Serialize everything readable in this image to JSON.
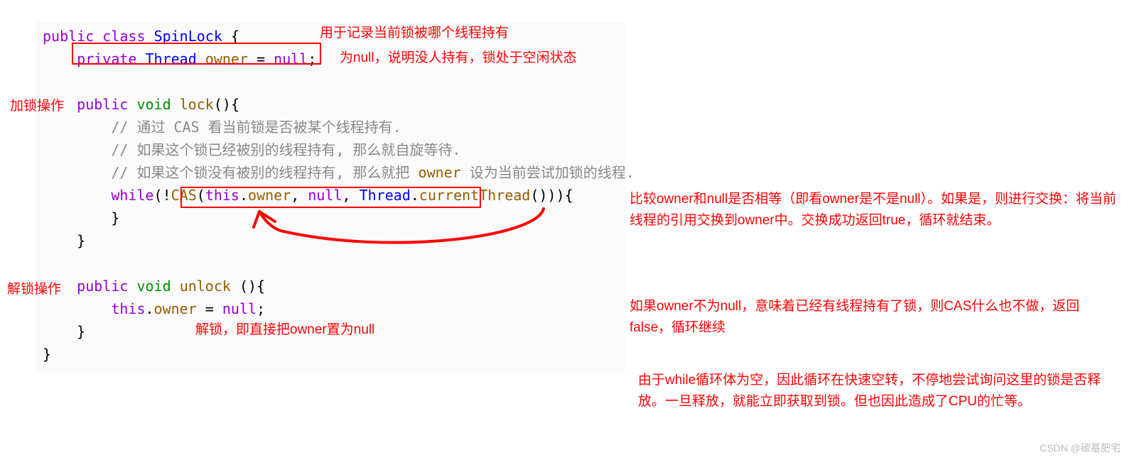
{
  "code": {
    "line1": {
      "public": "public",
      "class": "class",
      "name": "SpinLock",
      "brace": " {"
    },
    "line2": {
      "private": "private",
      "thread": "Thread",
      "owner": "owner",
      "eq": " = ",
      "null": "null",
      "semi": ";"
    },
    "line3": {
      "public": "public",
      "void": "void",
      "fn": "lock",
      "rest": "(){"
    },
    "comment1": "// 通过 CAS 看当前锁是否被某个线程持有.",
    "comment2": "// 如果这个锁已经被别的线程持有, 那么就自旋等待.",
    "comment3_part1": "// 如果这个锁没有被别的线程持有, 那么就把 ",
    "comment3_owner": "owner",
    "comment3_part2": " 设为当前尝试加锁的线程.",
    "line7": {
      "while": "while",
      "open": "(!",
      "cas": "CAS",
      "p1": "(",
      "this": "this",
      "dot1": ".",
      "owner": "owner",
      "comma1": ", ",
      "null": "null",
      "comma2": ", ",
      "thread": "Thread",
      "dot2": ".",
      "ct": "currentThread",
      "p2": "())){",
      "rest": ""
    },
    "line8": "        }",
    "line9": "    }",
    "line11": {
      "public": "public",
      "void": "void",
      "fn": "unlock",
      "rest": " (){"
    },
    "line12": {
      "this": "this",
      "dot": ".",
      "owner": "owner",
      "eq": " = ",
      "null": "null",
      "semi": ";"
    },
    "line13": "    }",
    "line14": "}"
  },
  "annotations": {
    "a1": "用于记录当前锁被哪个线程持有",
    "a2": "为null，说明没人持有，锁处于空闲状态",
    "a3": "加锁操作",
    "a4": "比较owner和null是否相等（即看owner是不是null）。如果是，则进行交换：将当前线程的引用交换到owner中。交换成功返回true，循环就结束。",
    "a5": "如果owner不为null，意味着已经有线程持有了锁，则CAS什么也不做，返回false，循环继续",
    "a6": "由于while循环体为空，因此循环在快速空转，不停地尝试询问这里的锁是否释放。一旦释放，就能立即获取到锁。但也因此造成了CPU的忙等。",
    "a7": "解锁操作",
    "a8": "解锁，即直接把owner置为null"
  },
  "watermark": "CSDN @碳基肥宅"
}
